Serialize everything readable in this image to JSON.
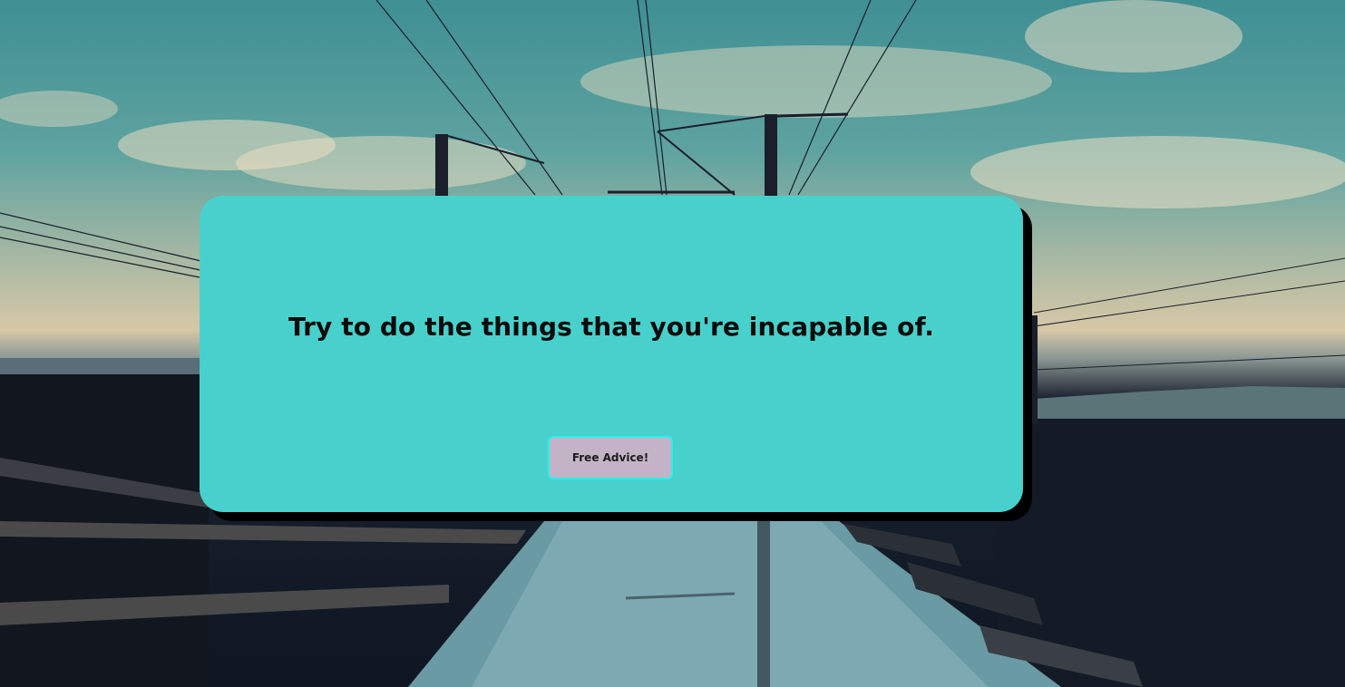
{
  "advice": {
    "text": "Try to do the things that you're incapable of."
  },
  "button": {
    "label": "Free Advice!"
  },
  "colors": {
    "card": "#48d1cc",
    "card_shadow": "#000000",
    "button": "#c4b3c6",
    "button_border": "#2af0ee",
    "text": "#0b0b0b"
  }
}
